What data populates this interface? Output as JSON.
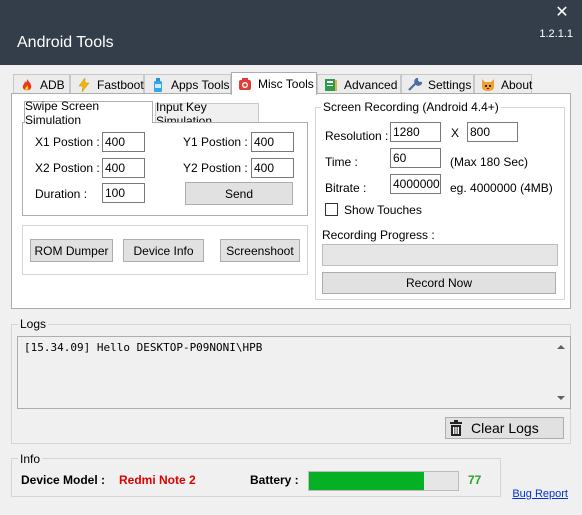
{
  "window": {
    "title": "Android Tools",
    "version": "1.2.1.1",
    "close_symbol": "✕"
  },
  "tabs": [
    {
      "label": "ADB",
      "icon": "flame-icon"
    },
    {
      "label": "Fastboot",
      "icon": "lightning-icon"
    },
    {
      "label": "Apps Tools",
      "icon": "bottle-icon"
    },
    {
      "label": "Misc Tools",
      "icon": "camera-icon",
      "active": true
    },
    {
      "label": "Advanced",
      "icon": "book-icon"
    },
    {
      "label": "Settings",
      "icon": "wrench-icon"
    },
    {
      "label": "About",
      "icon": "cat-icon"
    }
  ],
  "misc": {
    "subtabs": [
      "Swipe Screen Simulation",
      "Input Key Simulation"
    ],
    "swipe": {
      "x1_label": "X1 Postion :",
      "x1": "400",
      "y1_label": "Y1 Postion :",
      "y1": "400",
      "x2_label": "X2 Postion :",
      "x2": "400",
      "y2_label": "Y2 Postion :",
      "y2": "400",
      "duration_label": "Duration :",
      "duration": "100",
      "send": "Send"
    },
    "buttons": {
      "rom_dumper": "ROM Dumper",
      "device_info": "Device Info",
      "screenshoot": "Screenshoot"
    },
    "recording": {
      "title": "Screen Recording (Android 4.4+)",
      "resolution_label": "Resolution :",
      "res_w": "1280",
      "x_sep": "X",
      "res_h": "800",
      "time_label": "Time :",
      "time": "60",
      "time_hint": "(Max 180 Sec)",
      "bitrate_label": "Bitrate :",
      "bitrate": "4000000",
      "bitrate_hint": "eg. 4000000 (4MB)",
      "show_touches": "Show Touches",
      "progress_label": "Recording Progress :",
      "progress_value": 0,
      "record_now": "Record Now"
    }
  },
  "logs": {
    "title": "Logs",
    "lines": [
      "[15.34.09] Hello DESKTOP-P09NONI\\HPB"
    ],
    "clear": "Clear Logs"
  },
  "info": {
    "title": "Info",
    "device_model_label": "Device Model :",
    "device_model": "Redmi Note 2",
    "battery_label": "Battery :",
    "battery_value": "77",
    "battery_fraction": 0.77,
    "bug_report": "Bug Report",
    "battery_color": "#06b025",
    "device_model_color": "#e00000",
    "battery_text_color": "#22aa22"
  }
}
